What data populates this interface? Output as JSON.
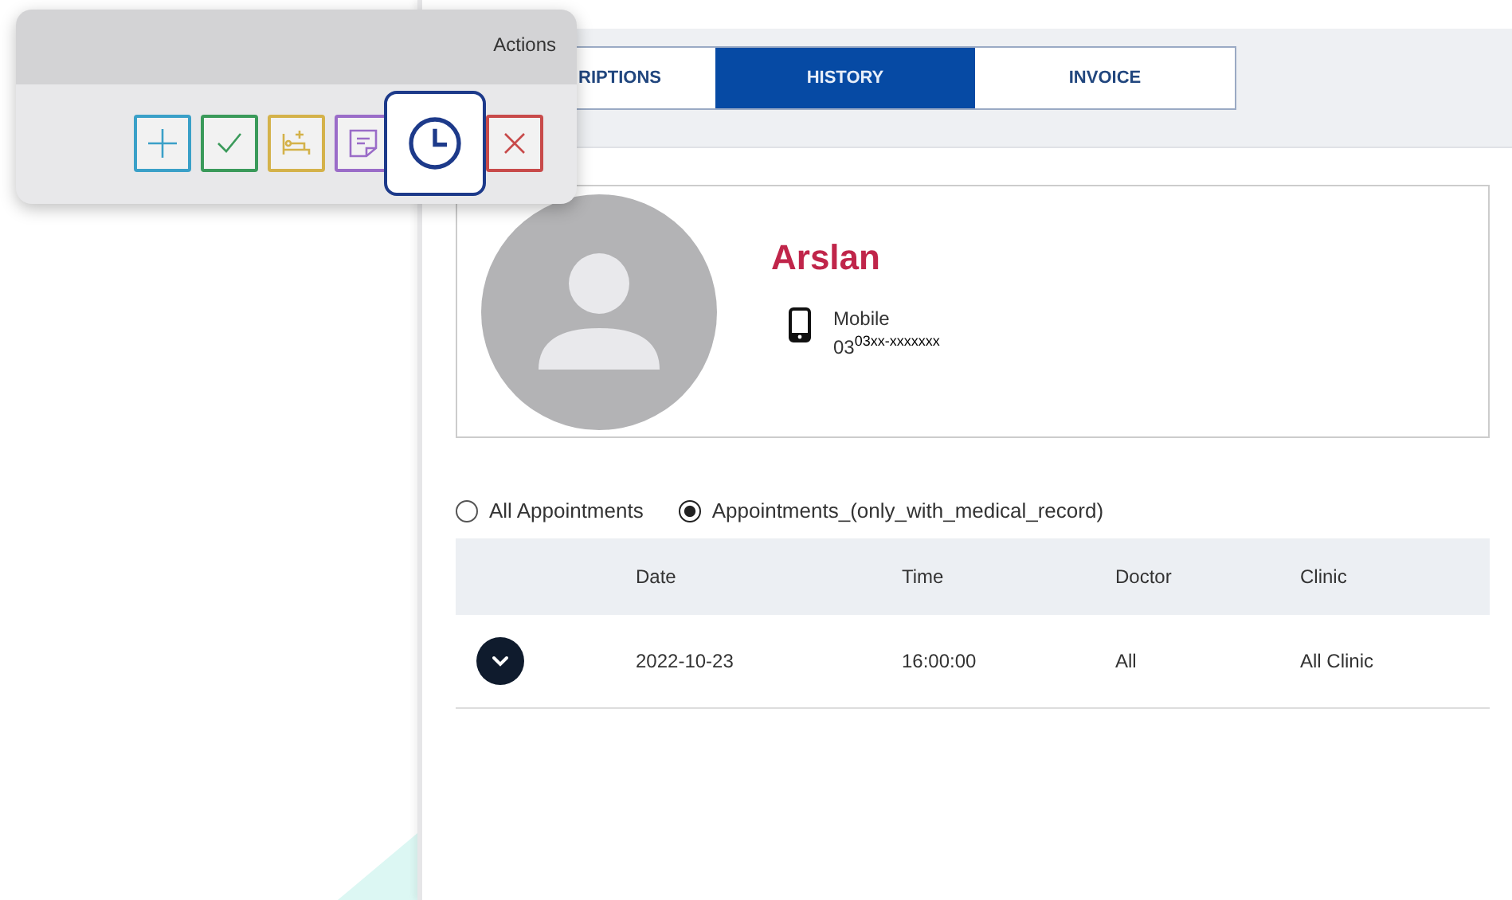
{
  "actions_popup": {
    "title": "Actions",
    "buttons": [
      {
        "kind": "add",
        "selected": false
      },
      {
        "kind": "confirm",
        "selected": false
      },
      {
        "kind": "admit",
        "selected": false
      },
      {
        "kind": "note",
        "selected": false
      },
      {
        "kind": "history",
        "selected": true
      },
      {
        "kind": "cancel",
        "selected": false
      }
    ]
  },
  "tabs": [
    {
      "label": "RIPTIONS",
      "selected": false
    },
    {
      "label": "HISTORY",
      "selected": true
    },
    {
      "label": "INVOICE",
      "selected": false
    }
  ],
  "patient": {
    "name": "Arslan",
    "phone_label": "Mobile",
    "phone": "03$^{03xx-xxxxxxx}$"
  },
  "filters": [
    {
      "label": "All Appointments",
      "selected": false
    },
    {
      "label": "Appointments_(only_with_medical_record)",
      "selected": true
    }
  ],
  "table": {
    "columns": [
      "Date",
      "Time",
      "Doctor",
      "Clinic"
    ],
    "rows": [
      {
        "expanded": false,
        "cells": [
          "2022-10-23",
          "16:00:00",
          "All",
          "All Clinic"
        ]
      }
    ]
  }
}
